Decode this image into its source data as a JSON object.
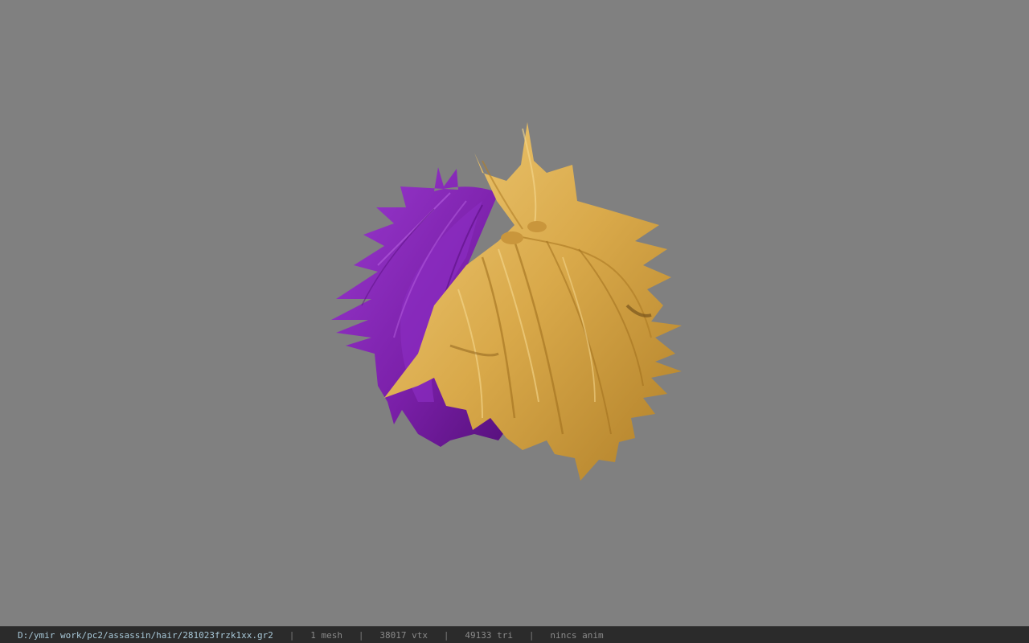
{
  "viewer": {
    "background_color": "#808080",
    "model_name": "hair-mesh",
    "hair_colors": {
      "purple": "#7a1fa8",
      "blonde": "#d9a94a"
    }
  },
  "statusbar": {
    "file_path": "D:/ymir work/pc2/assassin/hair/281023frzk1xx.gr2",
    "separator": "|",
    "mesh_count": "1 mesh",
    "vertex_count": "38017 vtx",
    "triangle_count": "49133 tri",
    "anim_status": "nincs anim"
  }
}
